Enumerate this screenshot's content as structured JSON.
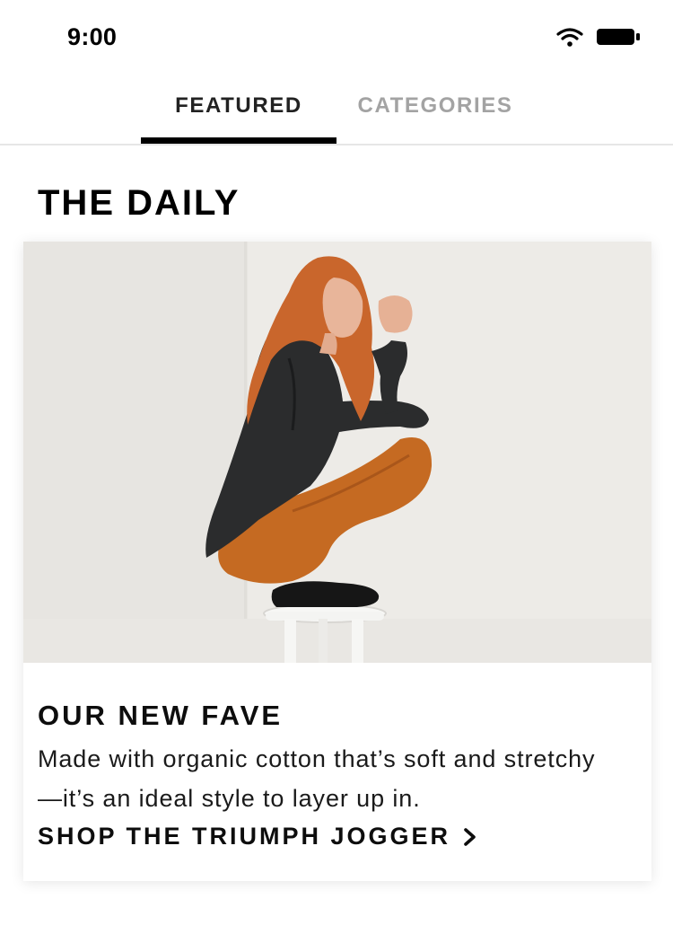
{
  "status_bar": {
    "time": "9:00",
    "icons": [
      "wifi-icon",
      "battery-icon"
    ]
  },
  "tabs": [
    {
      "label": "FEATURED",
      "active": true
    },
    {
      "label": "CATEGORIES",
      "active": false
    }
  ],
  "section": {
    "title": "THE DAILY"
  },
  "card": {
    "image": "model-photo",
    "title": "OUR NEW FAVE",
    "body": "Made with organic cotton that’s soft and stretchy—it’s an ideal style to layer up in.",
    "cta_label": "SHOP THE TRIUMPH JOGGER",
    "cta_icon": "chevron-right-icon"
  },
  "colors": {
    "active_tab": "#222222",
    "inactive_tab": "#a3a3a3",
    "underline": "#000000",
    "divider": "#e6e6e6"
  }
}
